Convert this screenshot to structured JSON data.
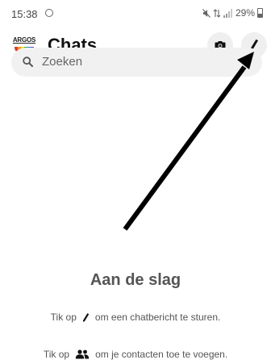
{
  "status_bar": {
    "time": "15:38",
    "battery_percent": "29%"
  },
  "header": {
    "logo_text": "ARGOS",
    "title": "Chats",
    "icons": [
      "camera-icon",
      "compose-icon"
    ]
  },
  "search": {
    "placeholder": "Zoeken"
  },
  "empty_state": {
    "title": "Aan de slag",
    "hint1_prefix": "Tik op",
    "hint1_suffix": "om een chatbericht te sturen.",
    "hint2_prefix": "Tik op",
    "hint2_suffix": "om je contacten toe te voegen."
  },
  "colors": {
    "icon": "#111111",
    "muted_text": "#555555",
    "search_bg": "#f1f1f1"
  }
}
